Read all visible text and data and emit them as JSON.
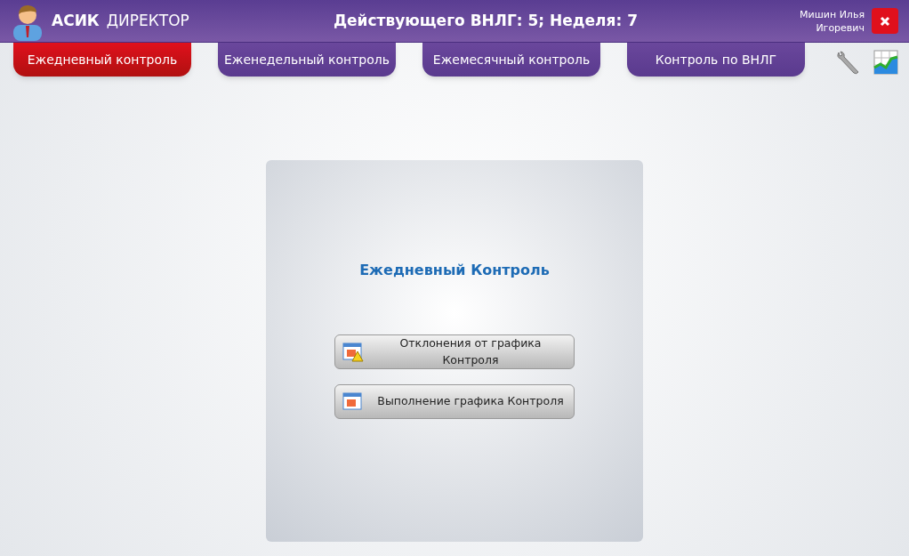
{
  "app": {
    "brand_bold": "АСИК",
    "brand": "ДИРЕКТОР"
  },
  "header": {
    "title": "Действующего ВНЛГ: 5; Неделя: 7",
    "user_line1": "Мишин Илья",
    "user_line2": "Игоревич"
  },
  "tabs": [
    {
      "label": "Ежедневный контроль",
      "selected": true
    },
    {
      "label": "Еженедельный контроль",
      "selected": false
    },
    {
      "label": "Ежемесячный контроль",
      "selected": false
    },
    {
      "label": "Контроль по ВНЛГ",
      "selected": false
    }
  ],
  "panel": {
    "title": "Ежедневный Контроль",
    "buttons": [
      {
        "label": "Отклонения от графика Контроля",
        "kind": "warning"
      },
      {
        "label": "Выполнение графика Контроля",
        "kind": "plain"
      }
    ]
  }
}
